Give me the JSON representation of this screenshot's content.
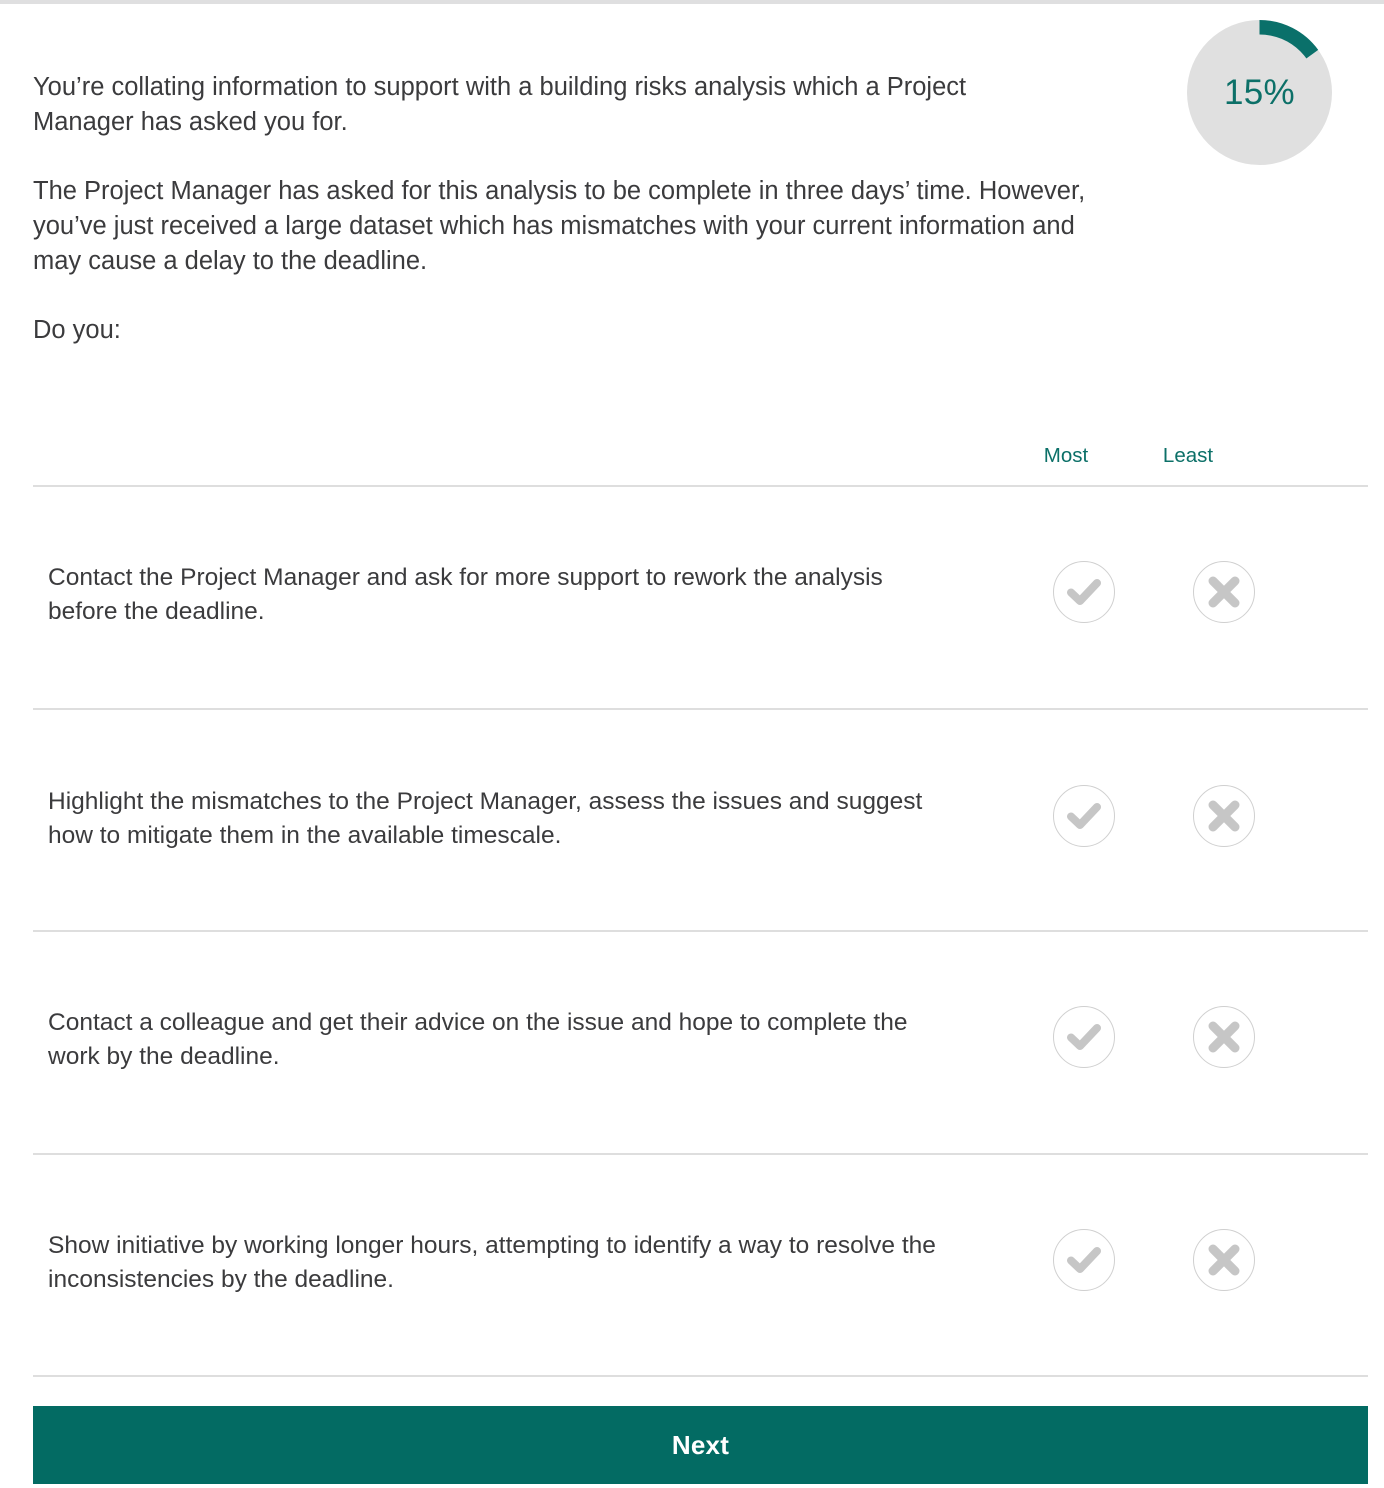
{
  "progress": {
    "value_label": "15%",
    "percent": 15,
    "track_color": "#e0e0e0",
    "arc_color": "#0a706a",
    "text_color": "#0c7068"
  },
  "scenario": {
    "paragraph_1": "You’re collating information to support with a building risks analysis which a Project Manager has asked you for.",
    "paragraph_2": "The Project Manager has asked for this analysis to be complete in three days’ time. However, you’ve just received a large dataset which has mismatches with your current information and may cause a delay to the deadline.",
    "paragraph_3": "Do you:"
  },
  "columns": {
    "most_label": "Most",
    "least_label": "Least",
    "accent_color": "#0c7068"
  },
  "options": [
    {
      "text": "Contact the Project Manager and ask for more support to rework the analysis before the deadline.",
      "most_icon": "check-icon",
      "least_icon": "cross-icon"
    },
    {
      "text": "Highlight the mismatches to the Project Manager, assess the issues and suggest how to mitigate them in the available timescale.",
      "most_icon": "check-icon",
      "least_icon": "cross-icon"
    },
    {
      "text": "Contact a colleague and get their advice on the issue and hope to complete the work by the deadline.",
      "most_icon": "check-icon",
      "least_icon": "cross-icon"
    },
    {
      "text": "Show initiative by working longer hours, attempting to identify a way to resolve the inconsistencies by the deadline.",
      "most_icon": "check-icon",
      "least_icon": "cross-icon"
    }
  ],
  "footer": {
    "next_label": "Next",
    "button_color": "#036b63"
  }
}
